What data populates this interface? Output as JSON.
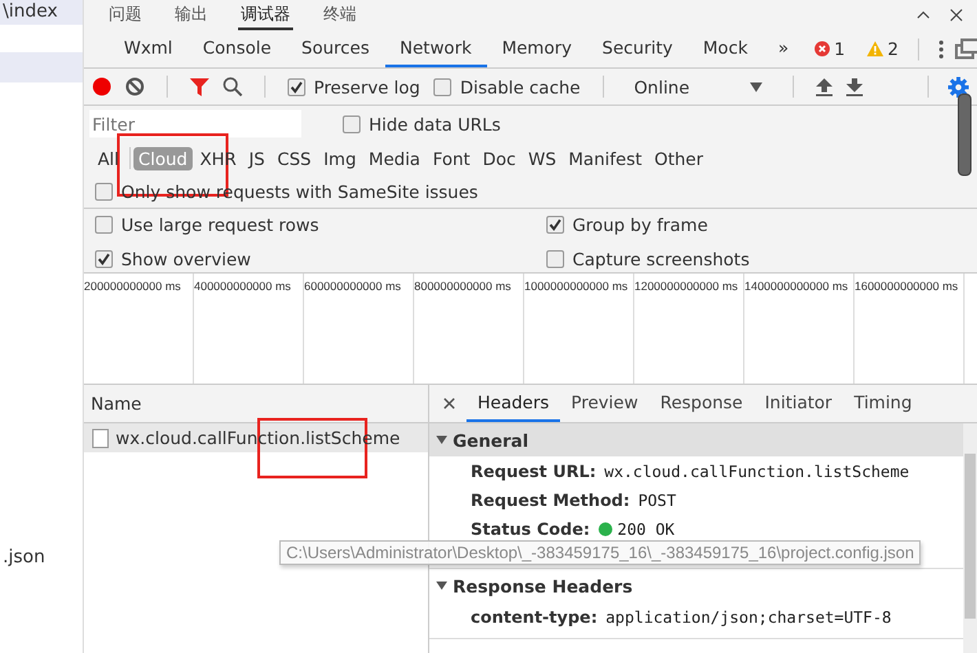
{
  "sidebar": {
    "items": [
      {
        "label": "\\index",
        "selected": true
      },
      {
        "label": ".json",
        "selected": false
      }
    ]
  },
  "top_tabs": [
    {
      "label": "问题",
      "selected": false
    },
    {
      "label": "输出",
      "selected": false
    },
    {
      "label": "调试器",
      "selected": true
    },
    {
      "label": "终端",
      "selected": false
    }
  ],
  "tabs": [
    {
      "label": "Wxml",
      "selected": false
    },
    {
      "label": "Console",
      "selected": false
    },
    {
      "label": "Sources",
      "selected": false
    },
    {
      "label": "Network",
      "selected": true
    },
    {
      "label": "Memory",
      "selected": false
    },
    {
      "label": "Security",
      "selected": false
    },
    {
      "label": "Mock",
      "selected": false
    }
  ],
  "more": "»",
  "errors": "1",
  "warnings": "2",
  "toolbar": {
    "preserve_log": {
      "label": "Preserve log",
      "checked": true
    },
    "disable_cache": {
      "label": "Disable cache",
      "checked": false
    },
    "throttle": "Online"
  },
  "filter": {
    "placeholder": "Filter",
    "hide_data_urls": {
      "label": "Hide data URLs",
      "checked": false
    }
  },
  "types": [
    {
      "label": "All",
      "selected": false
    },
    {
      "label": "Cloud",
      "selected": true
    },
    {
      "label": "XHR",
      "selected": false
    },
    {
      "label": "JS",
      "selected": false
    },
    {
      "label": "CSS",
      "selected": false
    },
    {
      "label": "Img",
      "selected": false
    },
    {
      "label": "Media",
      "selected": false
    },
    {
      "label": "Font",
      "selected": false
    },
    {
      "label": "Doc",
      "selected": false
    },
    {
      "label": "WS",
      "selected": false
    },
    {
      "label": "Manifest",
      "selected": false
    },
    {
      "label": "Other",
      "selected": false
    }
  ],
  "samesite": {
    "label": "Only show requests with SameSite issues",
    "checked": false
  },
  "settings": [
    {
      "label": "Use large request rows",
      "checked": false
    },
    {
      "label": "Group by frame",
      "checked": true
    },
    {
      "label": "Show overview",
      "checked": true
    },
    {
      "label": "Capture screenshots",
      "checked": false
    }
  ],
  "overview_ticks": [
    "200000000000 ms",
    "400000000000 ms",
    "600000000000 ms",
    "800000000000 ms",
    "1000000000000 ms",
    "1200000000000 ms",
    "1400000000000 ms",
    "1600000000000 ms"
  ],
  "requests": {
    "column": "Name",
    "rows": [
      {
        "name": "wx.cloud.callFunction.listScheme",
        "selected": true
      }
    ]
  },
  "detail_tabs": [
    {
      "label": "Headers",
      "selected": true
    },
    {
      "label": "Preview",
      "selected": false
    },
    {
      "label": "Response",
      "selected": false
    },
    {
      "label": "Initiator",
      "selected": false
    },
    {
      "label": "Timing",
      "selected": false
    }
  ],
  "sections": [
    {
      "title": "General",
      "expanded": true,
      "rows": [
        {
          "key": "Request URL:",
          "value": "wx.cloud.callFunction.listScheme"
        },
        {
          "key": "Request Method:",
          "value": "POST"
        },
        {
          "key": "Status Code:",
          "value": "200 OK",
          "status": true
        }
      ]
    },
    {
      "title": "Response Headers",
      "expanded": true,
      "rows": [
        {
          "key": "content-type:",
          "value": "application/json;charset=UTF-8"
        }
      ]
    }
  ],
  "tooltip": "C:\\Users\\Administrator\\Desktop\\_-383459175_16\\_-383459175_16\\project.config.json"
}
